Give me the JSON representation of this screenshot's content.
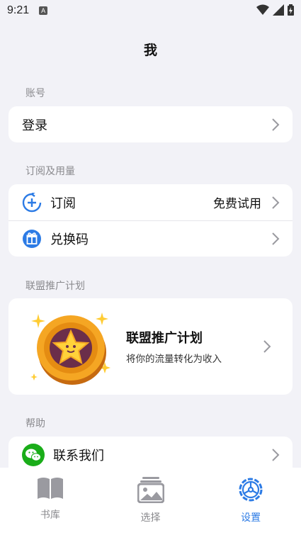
{
  "status": {
    "time": "9:21",
    "notification_glyph": "A"
  },
  "header": {
    "title": "我"
  },
  "sections": {
    "account": {
      "label": "账号",
      "login_label": "登录"
    },
    "subscription": {
      "label": "订阅及用量",
      "subscribe_label": "订阅",
      "subscribe_value": "免费试用",
      "redeem_label": "兑换码"
    },
    "affiliate": {
      "label": "联盟推广计划",
      "title": "联盟推广计划",
      "subtitle": "将你的流量转化为收入"
    },
    "help": {
      "label": "帮助",
      "contact_label": "联系我们"
    }
  },
  "tabs": [
    {
      "label": "书库",
      "icon": "book-icon",
      "active": false
    },
    {
      "label": "选择",
      "icon": "gallery-icon",
      "active": false
    },
    {
      "label": "设置",
      "icon": "settings-icon",
      "active": true
    }
  ],
  "colors": {
    "accent": "#2c7be5",
    "wechat_green": "#1aad19",
    "background": "#f2f2f7"
  }
}
